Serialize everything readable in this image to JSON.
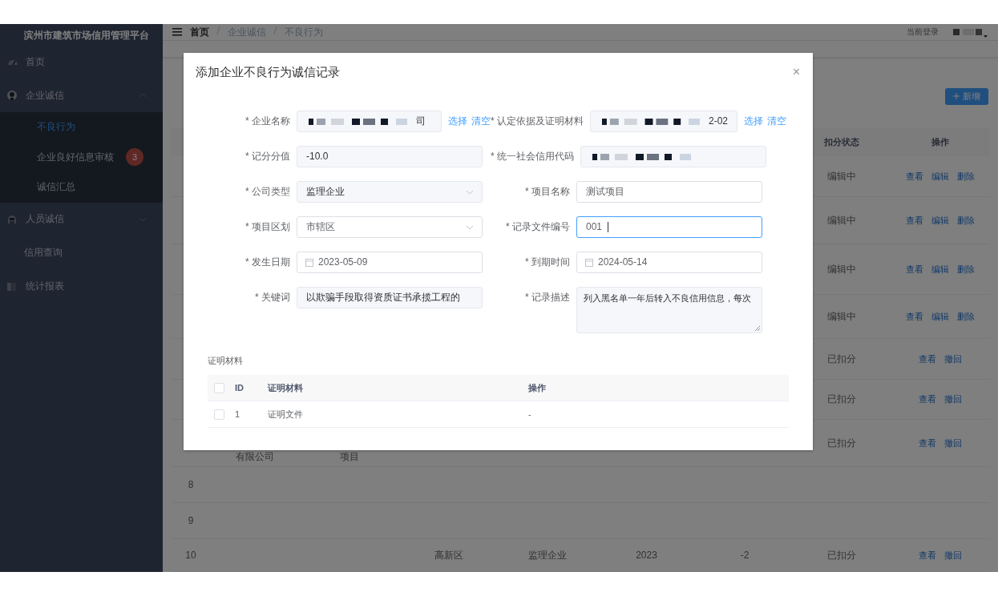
{
  "sidebar": {
    "title": "滨州市建筑市场信用管理平台",
    "items": [
      {
        "label": "首页",
        "selected": false
      },
      {
        "label": "企业诚信",
        "expanded": true,
        "selected": false,
        "children": [
          {
            "label": "不良行为",
            "selected": true
          },
          {
            "label": "企业良好信息审核",
            "selected": false,
            "badge": "3"
          },
          {
            "label": "诚信汇总",
            "selected": false
          }
        ]
      },
      {
        "label": "人员诚信",
        "expanded": false,
        "selected": false
      },
      {
        "label": "信用查询",
        "selected": false
      },
      {
        "label": "统计报表",
        "selected": false
      }
    ]
  },
  "header": {
    "breadcrumb": [
      "首页",
      "企业诚信",
      "不良行为"
    ],
    "user_label": "当前登录"
  },
  "card": {
    "add_button": "新增",
    "columns": [
      "扣分状态",
      "操作"
    ],
    "rows": [
      {
        "status": "编辑中",
        "actions": [
          "查看",
          "编辑",
          "删除"
        ]
      },
      {
        "status": "编辑中",
        "actions": [
          "查看",
          "编辑",
          "删除"
        ]
      },
      {
        "status": "编辑中",
        "actions": [
          "查看",
          "编辑",
          "删除"
        ]
      },
      {
        "status": "编辑中",
        "actions": [
          "查看",
          "编辑",
          "删除"
        ]
      },
      {
        "status": "已扣分",
        "actions": [
          "查看",
          "撤回"
        ]
      },
      {
        "status": "已扣分",
        "actions": [
          "查看",
          "撤回"
        ]
      },
      {
        "company": "有限公司",
        "project": "项目",
        "status": "已扣分",
        "actions": [
          "查看",
          "撤回"
        ]
      },
      {
        "index": "8"
      },
      {
        "index": "9"
      },
      {
        "index": "10",
        "district": "高新区",
        "type": "监理企业",
        "year": "2023",
        "score": "-2",
        "status": "已扣分",
        "actions": [
          "查看",
          "撤回"
        ]
      }
    ]
  },
  "modal": {
    "title": "添加企业不良行为诚信记录",
    "close": "×",
    "fields": [
      {
        "label": "* 企业名称",
        "kind": "picker",
        "value": "司",
        "redacted": true,
        "readonly": true,
        "focused": false,
        "links": [
          "选择",
          "清空"
        ]
      },
      {
        "label": "* 认定依据及证明材料",
        "kind": "picker",
        "value": "2-02",
        "redacted": true,
        "readonly": true,
        "focused": false,
        "links": [
          "选择",
          "清空"
        ]
      },
      {
        "label": "* 记分分值",
        "kind": "text",
        "value": "-10.0",
        "redacted": false,
        "readonly": true,
        "focused": false
      },
      {
        "label": "* 统一社会信用代码",
        "kind": "text",
        "redacted": true,
        "readonly": true,
        "focused": false
      },
      {
        "label": "* 公司类型",
        "kind": "select",
        "value": "监理企业",
        "redacted": false,
        "readonly": true,
        "focused": false
      },
      {
        "label": "* 项目名称",
        "kind": "text",
        "value": "测试项目",
        "redacted": false,
        "readonly": false,
        "focused": false
      },
      {
        "label": "* 项目区划",
        "kind": "select",
        "value": "市辖区",
        "redacted": false,
        "readonly": false,
        "focused": false
      },
      {
        "label": "* 记录文件编号",
        "kind": "text",
        "value": "001",
        "redacted": false,
        "readonly": false,
        "focused": true
      },
      {
        "label": "* 发生日期",
        "kind": "date",
        "value": "2023-05-09",
        "redacted": false,
        "readonly": false,
        "focused": false
      },
      {
        "label": "* 到期时间",
        "kind": "date",
        "value": "2024-05-14",
        "redacted": false,
        "readonly": false,
        "focused": false
      },
      {
        "label": "* 关键词",
        "kind": "text",
        "value": "以欺骗手段取得资质证书承揽工程的",
        "redacted": false,
        "readonly": true,
        "focused": false
      },
      {
        "label": "* 记录描述",
        "kind": "textarea",
        "value": "列入黑名单一年后转入不良信用信息，每次",
        "redacted": false,
        "readonly": true,
        "focused": false
      }
    ],
    "materials": {
      "title": "证明材料",
      "header_checked": false,
      "columns": [
        "ID",
        "证明材料",
        "操作"
      ],
      "rows": [
        {
          "checked": false,
          "cells": [
            "1",
            "证明文件",
            "-"
          ]
        }
      ]
    }
  }
}
